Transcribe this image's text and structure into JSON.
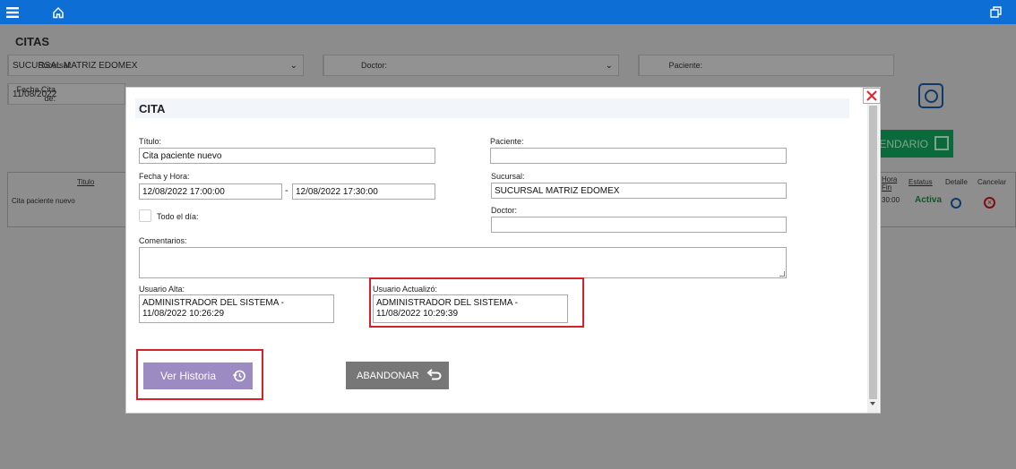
{
  "topbar": {
    "menu_icon": "hamburger-icon",
    "home_icon": "home-icon",
    "window_icon": "restore-window-icon"
  },
  "background": {
    "page_title": "CITAS",
    "sucursal_label": "Sucursal:",
    "sucursal_value": "SUCURSAL MATRIZ EDOMEX",
    "doctor_label": "Doctor:",
    "doctor_value": "",
    "paciente_label": "Paciente:",
    "paciente_value": "",
    "fecha_label": "Fecha Cita de:",
    "fecha_value": "11/08/2022",
    "calendar_button": "ENDARIO",
    "table": {
      "headers": [
        "Titulo",
        "Hora Fin",
        "Estatus",
        "Detalle",
        "Cancelar"
      ],
      "row": {
        "titulo": "Cita paciente nuevo",
        "hora": "30:00",
        "estatus": "Activa"
      }
    }
  },
  "modal": {
    "title": "CITA",
    "titulo_label": "Título:",
    "titulo_value": "Cita paciente nuevo",
    "fecha_hora_label": "Fecha y Hora:",
    "fecha_inicio": "12/08/2022 17:00:00",
    "fecha_separator": "-",
    "fecha_fin": "12/08/2022 17:30:00",
    "todo_dia_label": "Todo el día:",
    "paciente_label": "Paciente:",
    "paciente_value": "",
    "sucursal_label": "Sucursal:",
    "sucursal_value": "SUCURSAL MATRIZ EDOMEX",
    "doctor_label": "Doctor:",
    "doctor_value": "",
    "comentarios_label": "Comentarios:",
    "comentarios_value": "",
    "usuario_alta_label": "Usuario Alta:",
    "usuario_alta_value": "ADMINISTRADOR DEL SISTEMA - 11/08/2022 10:26:29",
    "usuario_actualizo_label": "Usuario Actualizó:",
    "usuario_actualizo_value": "ADMINISTRADOR DEL SISTEMA - 11/08/2022 10:29:39",
    "ver_historia_label": "Ver Historia",
    "abandonar_label": "ABANDONAR"
  },
  "colors": {
    "topbar": "#0d6fd6",
    "highlight": "#d6202b",
    "historia_button": "#9b8bc2",
    "abandonar_button": "#777777"
  }
}
